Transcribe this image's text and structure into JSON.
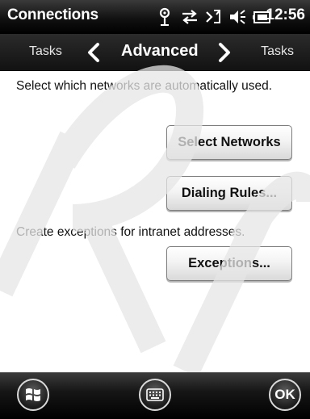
{
  "status_bar": {
    "title": "Connections",
    "time": "12:56",
    "icons": [
      "antenna-icon",
      "data-transfer-icon",
      "signal-off-icon",
      "volume-icon",
      "battery-icon"
    ]
  },
  "nav_bar": {
    "left_label": "Tasks",
    "title": "Advanced",
    "right_label": "Tasks",
    "icons": [
      "chevron-left-icon",
      "chevron-right-icon"
    ]
  },
  "main": {
    "networks_description": "Select which networks are automatically used.",
    "select_networks_label": "Select Networks",
    "dialing_rules_label": "Dialing Rules...",
    "exceptions_description": "Create exceptions for intranet addresses.",
    "exceptions_label": "Exceptions..."
  },
  "bottom_bar": {
    "ok_label": "OK",
    "icons": [
      "windows-start-icon",
      "keyboard-icon"
    ]
  },
  "colors": {
    "bar_dark": "#111111",
    "content_bg": "#ffffff",
    "watermark": "#e6e6e6"
  }
}
